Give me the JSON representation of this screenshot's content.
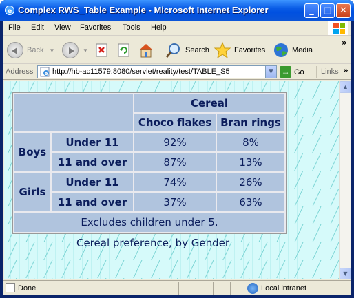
{
  "window": {
    "title": "Complex RWS_Table Example - Microsoft Internet Explorer",
    "controls": {
      "minimize": "_",
      "maximize": "□",
      "close": "✕"
    }
  },
  "menubar": {
    "items": [
      {
        "label": "File"
      },
      {
        "label": "Edit"
      },
      {
        "label": "View"
      },
      {
        "label": "Favorites"
      },
      {
        "label": "Tools"
      },
      {
        "label": "Help"
      }
    ]
  },
  "toolbar": {
    "back_label": "Back",
    "search_label": "Search",
    "favorites_label": "Favorites",
    "media_label": "Media",
    "chevron": "»"
  },
  "address": {
    "label": "Address",
    "url": "http://hb-ac11579:8080/servlet/reality/test/TABLE_S5",
    "go_label": "Go",
    "links_label": "Links"
  },
  "table": {
    "column_group": "Cereal",
    "columns": [
      "Choco flakes",
      "Bran rings"
    ],
    "groups": [
      {
        "label": "Boys",
        "rows": [
          {
            "label": "Under 11",
            "values": [
              "92%",
              "8%"
            ]
          },
          {
            "label": "11 and over",
            "values": [
              "87%",
              "13%"
            ]
          }
        ]
      },
      {
        "label": "Girls",
        "rows": [
          {
            "label": "Under 11",
            "values": [
              "74%",
              "26%"
            ]
          },
          {
            "label": "11 and over",
            "values": [
              "37%",
              "63%"
            ]
          }
        ]
      }
    ],
    "footnote": "Excludes children under 5.",
    "caption": "Cereal preference, by Gender"
  },
  "statusbar": {
    "status": "Done",
    "zone": "Local intranet"
  },
  "colors": {
    "cell_bg": "#b0c4de",
    "text": "#0b1d5c",
    "page_bg": "#d6fafa"
  }
}
